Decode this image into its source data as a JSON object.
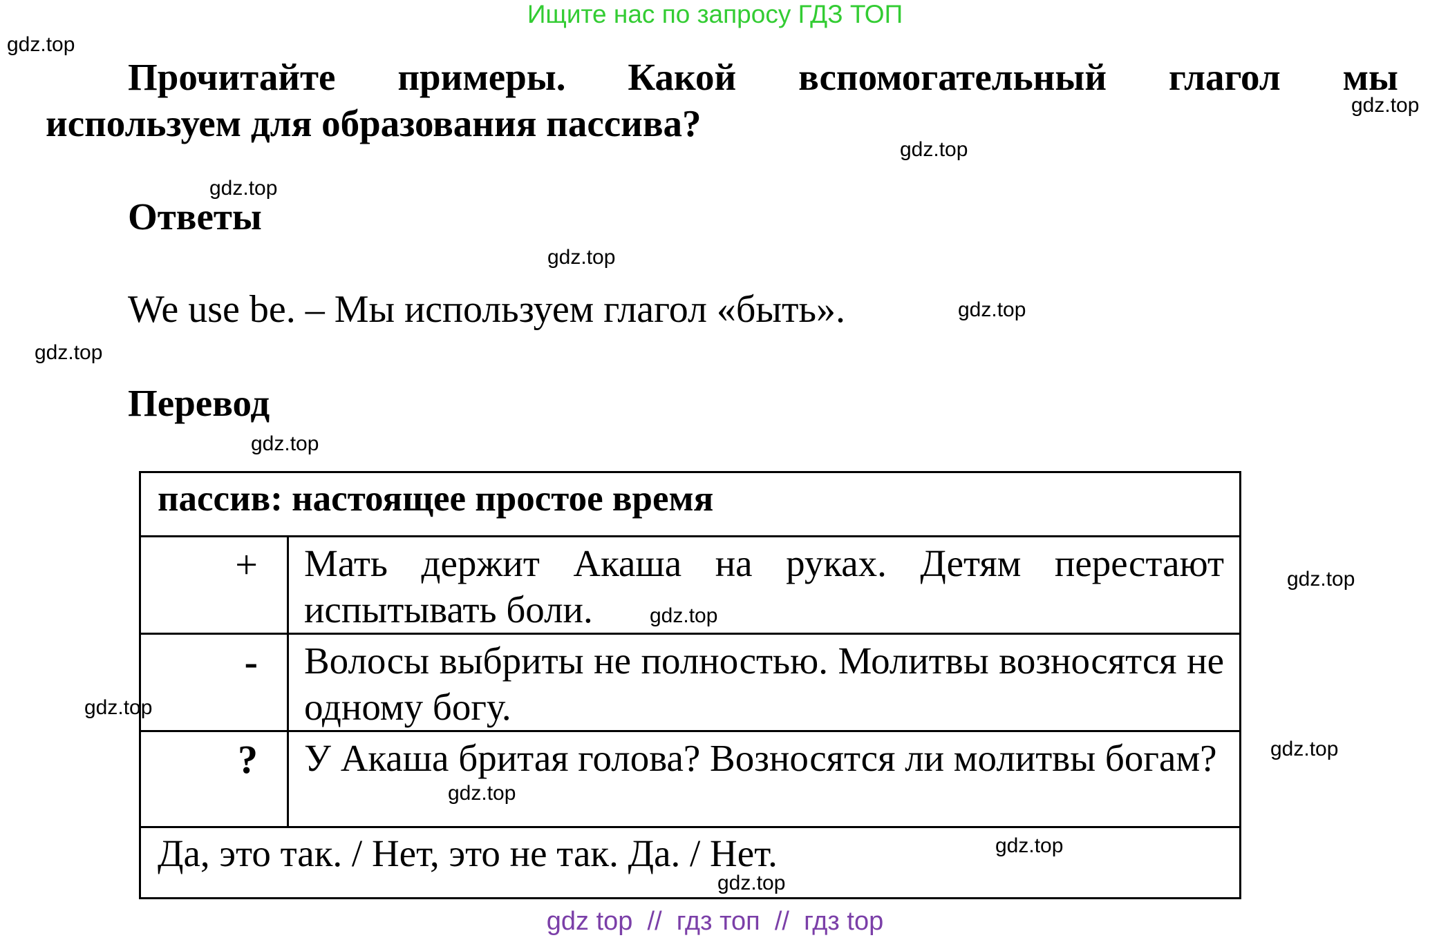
{
  "banner": "Ищите нас по запросу ГДЗ ТОП",
  "watermark": "gdz.top",
  "question": {
    "line1": "Прочитайте примеры. Какой вспомогательный глагол мы",
    "line2": "используем для образования пассива?"
  },
  "answers_heading": "Ответы",
  "answer_text": "We use be. – Мы используем глагол «быть».",
  "translation_heading": "Перевод",
  "table": {
    "header": "пассив: настоящее простое время",
    "rows": [
      {
        "symbol": "+",
        "text": "Мать держит Акаша на руках. Детям перестают испытывать боли."
      },
      {
        "symbol": "-",
        "text": "Волосы выбриты не полностью. Молитвы возносятся не одному богу."
      },
      {
        "symbol": "?",
        "text": "У Акаша бритая голова? Возносятся ли молитвы богам?"
      }
    ],
    "footer_row": "Да, это так. / Нет, это не так. Да. / Нет."
  },
  "footer": "gdz top  //  гдз топ  //  гдз top"
}
